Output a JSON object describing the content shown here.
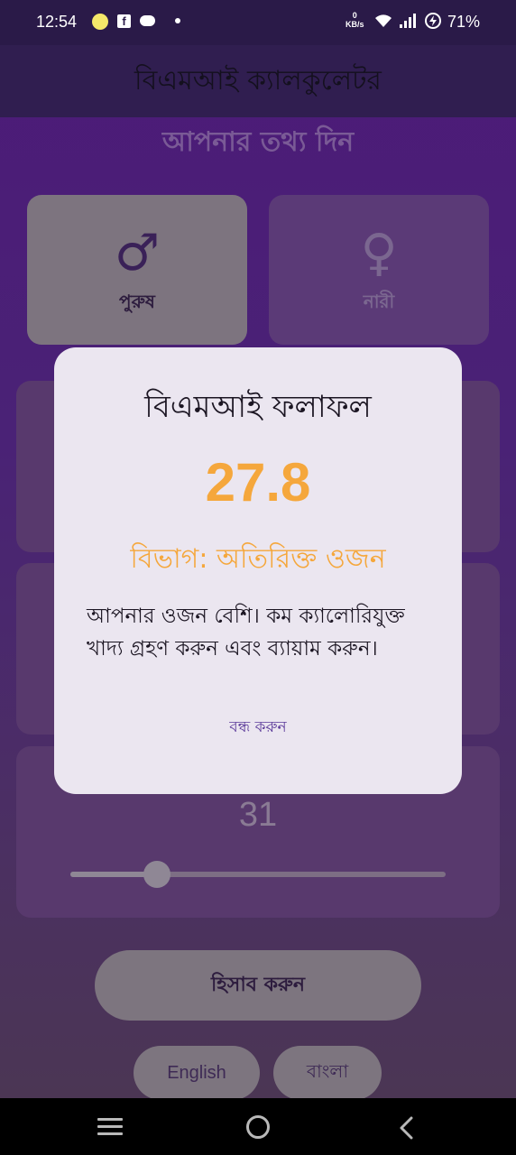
{
  "status_bar": {
    "time": "12:54",
    "net_speed_value": "0",
    "net_speed_unit": "KB/s",
    "battery": "71%"
  },
  "app_bar": {
    "title": "বিএমআই ক্যালকুলেটর"
  },
  "main": {
    "heading": "আপনার তথ্য দিন",
    "gender": {
      "male": {
        "label": "পুরুষ",
        "symbol": "♂",
        "selected": true
      },
      "female": {
        "label": "নারী",
        "symbol": "♀",
        "selected": false
      }
    },
    "age": {
      "value": "31",
      "slider_fraction": 0.23
    },
    "calculate_label": "হিসাব করুন",
    "language": {
      "english_label": "English",
      "bangla_label": "বাংলা"
    }
  },
  "dialog": {
    "title": "বিএমআই ফলাফল",
    "bmi": "27.8",
    "category": "বিভাগ: অতিরিক্ত ওজন",
    "message": "আপনার ওজন বেশি। কম ক্যালোরিযুক্ত খাদ্য গ্রহণ করুন এবং ব্যায়াম করুন।",
    "close_label": "বন্ধ করুন",
    "accent_color": "#f5a73c"
  }
}
